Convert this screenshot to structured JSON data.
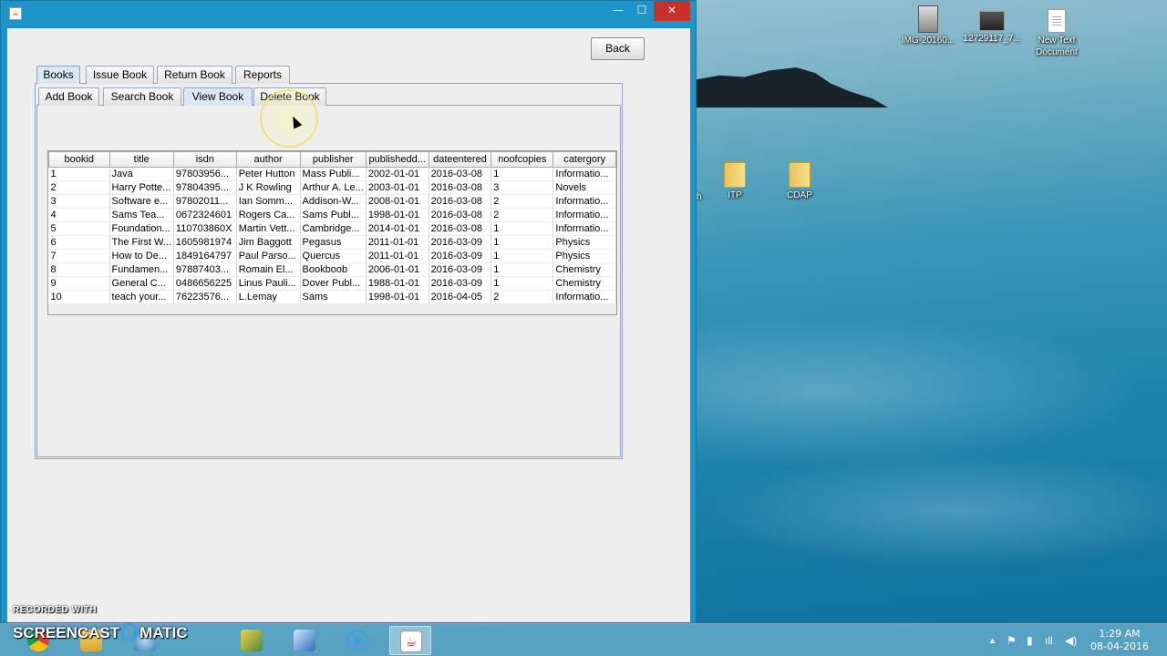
{
  "desktop": {
    "icons": [
      {
        "label": "IMG-20160...",
        "icon": "image-file-icon"
      },
      {
        "label": "12729117_7...",
        "icon": "dark-image-file-icon"
      },
      {
        "label": "New Text Document",
        "icon": "text-document-icon"
      },
      {
        "label": "h",
        "icon": "partial-label"
      },
      {
        "label": "ITP",
        "icon": "folder-icon"
      },
      {
        "label": "CDAP",
        "icon": "folder-icon"
      }
    ]
  },
  "window": {
    "controls": {
      "minimize": "—",
      "maximize": "☐",
      "close": "✕"
    },
    "back_label": "Back",
    "main_tabs": [
      {
        "label": "Books",
        "active": true
      },
      {
        "label": "Issue Book",
        "active": false
      },
      {
        "label": "Return Book",
        "active": false
      },
      {
        "label": "Reports",
        "active": false
      }
    ],
    "sub_tabs": [
      {
        "label": "Add Book",
        "active": false
      },
      {
        "label": "Search Book",
        "active": false
      },
      {
        "label": "View Book",
        "active": true
      },
      {
        "label": "Delete Book",
        "active": false
      }
    ],
    "table": {
      "columns": [
        "bookid",
        "title",
        "isdn",
        "author",
        "publisher",
        "publishedd...",
        "dateentered",
        "noofcopies",
        "catergory"
      ],
      "rows": [
        [
          "1",
          "Java",
          "97803956...",
          "Peter Hutton",
          "Mass Publi...",
          "2002-01-01",
          "2016-03-08",
          "1",
          "Informatio..."
        ],
        [
          "2",
          "Harry Potte...",
          "97804395...",
          "J K Rowling",
          "Arthur A. Le...",
          "2003-01-01",
          "2016-03-08",
          "3",
          "Novels"
        ],
        [
          "3",
          "Software e...",
          "97802011...",
          "Ian Somm...",
          "Addison-W...",
          "2008-01-01",
          "2016-03-08",
          "2",
          "Informatio..."
        ],
        [
          "4",
          "Sams Tea...",
          "0672324601",
          "Rogers Ca...",
          "Sams Publ...",
          "1998-01-01",
          "2016-03-08",
          "2",
          "Informatio..."
        ],
        [
          "5",
          "Foundation...",
          "110703860X",
          "Martin Vett...",
          "Cambridge...",
          "2014-01-01",
          "2016-03-08",
          "1",
          "Informatio..."
        ],
        [
          "6",
          "The First W...",
          "1605981974",
          "Jim Baggott",
          "Pegasus",
          "2011-01-01",
          "2016-03-09",
          "1",
          "Physics"
        ],
        [
          "7",
          "How to De...",
          "1849164797",
          "Paul Parso...",
          "Quercus",
          "2011-01-01",
          "2016-03-09",
          "1",
          "Physics"
        ],
        [
          "8",
          "Fundamen...",
          "97887403...",
          "Romain El...",
          "Bookboob",
          "2006-01-01",
          "2016-03-09",
          "1",
          "Chemistry"
        ],
        [
          "9",
          "General C...",
          "0486656225",
          "Linus Pauli...",
          "Dover Publ...",
          "1988-01-01",
          "2016-03-09",
          "1",
          "Chemistry"
        ],
        [
          "10",
          "teach your...",
          "76223576...",
          "L.Lemay",
          "Sams",
          "1998-01-01",
          "2016-04-05",
          "2",
          "Informatio..."
        ]
      ]
    }
  },
  "taskbar": {
    "clock_time": "1:29 AM",
    "clock_date": "08-04-2016",
    "tray": {
      "up": "▲",
      "flag": "⚑",
      "power": "▮",
      "signal": "ıll",
      "volume": "◀)"
    }
  },
  "watermark": {
    "line1": "RECORDED WITH",
    "left": "SCREENCAST",
    "right": "MATIC"
  },
  "colors": {
    "window_frame": "#1d95c9",
    "close_button": "#c7312a",
    "client_bg": "#eeeeee",
    "active_tab": "#dbe8f4",
    "taskbar": "#64aac8"
  }
}
